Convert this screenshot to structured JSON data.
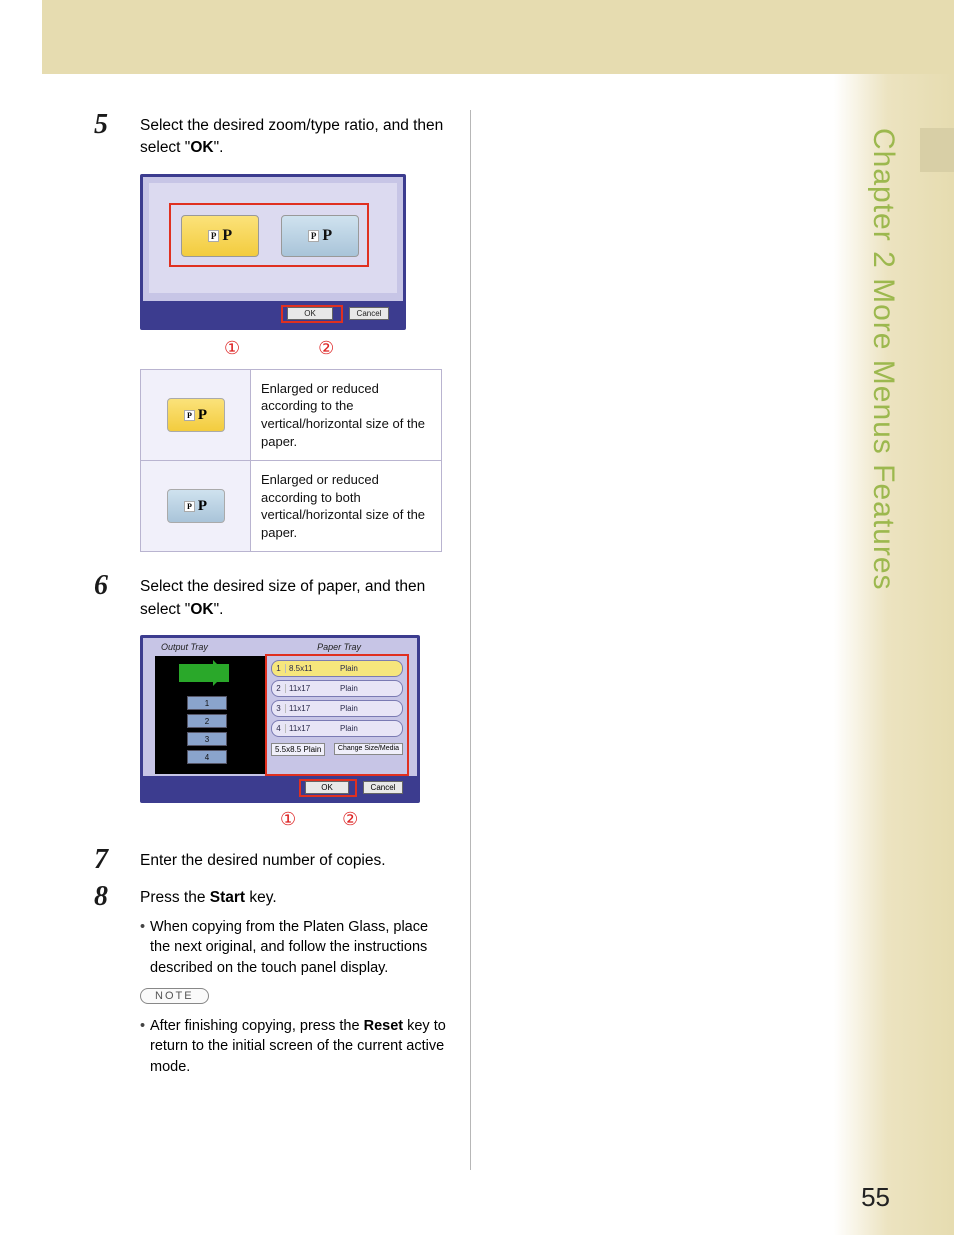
{
  "page_number": "55",
  "chapter_tab": "Chapter 2    More Menus Features",
  "steps": {
    "s5": {
      "num": "5",
      "text_a": "Select the desired zoom/type ratio, and then select \"",
      "bold": "OK",
      "text_b": "\"."
    },
    "s6": {
      "num": "6",
      "text_a": "Select the desired size of paper, and then select \"",
      "bold": "OK",
      "text_b": "\"."
    },
    "s7": {
      "num": "7",
      "text": "Enter the desired number of copies."
    },
    "s8": {
      "num": "8",
      "text_a": "Press the ",
      "bold": "Start",
      "text_b": " key."
    }
  },
  "bullets": {
    "b8a": "When copying from the Platen Glass, place the next original, and follow the instructions described on the touch panel display.",
    "note_label": "NOTE",
    "b8n_a": "After finishing copying, press the ",
    "b8n_bold": "Reset",
    "b8n_b": " key to return to the initial screen of the current active mode."
  },
  "fig1": {
    "btn_p": "P",
    "ok": "OK",
    "cancel": "Cancel",
    "m1": "①",
    "m2": "②"
  },
  "explain": {
    "row1": "Enlarged or reduced according to the vertical/horizontal size of the paper.",
    "row2": "Enlarged or reduced according to both vertical/horizontal size of the paper."
  },
  "fig2": {
    "hdrL": "Output Tray",
    "hdrR": "Paper Tray",
    "rows": [
      {
        "n": "1",
        "size": "8.5x11",
        "type": "Plain"
      },
      {
        "n": "2",
        "size": "11x17",
        "type": "Plain"
      },
      {
        "n": "3",
        "size": "11x17",
        "type": "Plain"
      },
      {
        "n": "4",
        "size": "11x17",
        "type": "Plain"
      }
    ],
    "bypass_size": "5.5x8.5",
    "bypass_type": "Plain",
    "change": "Change Size/Media",
    "ok": "OK",
    "cancel": "Cancel",
    "m1": "①",
    "m2": "②",
    "slot1": "1",
    "slot2": "2",
    "slot3": "3",
    "slot4": "4"
  }
}
